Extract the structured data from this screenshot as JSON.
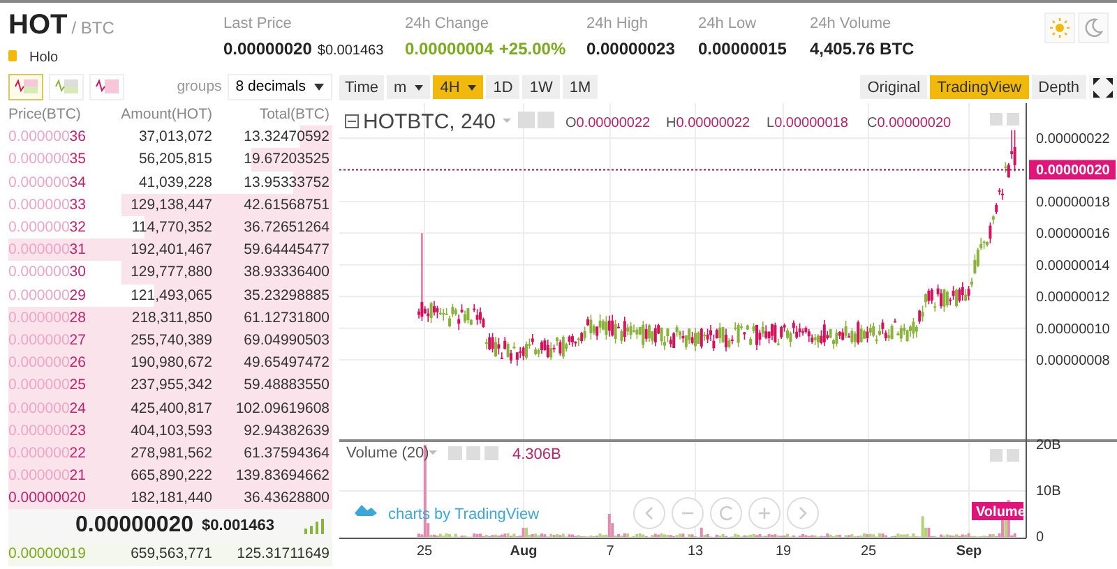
{
  "header": {
    "symbol": "HOT",
    "quote": "/ BTC",
    "name": "Holo",
    "stats": [
      {
        "label": "Last Price",
        "value": "0.00000020",
        "extra": "$0.001463"
      },
      {
        "label": "24h Change",
        "value": "0.00000004",
        "extra": "+25.00%"
      },
      {
        "label": "24h High",
        "value": "0.00000023"
      },
      {
        "label": "24h Low",
        "value": "0.00000015"
      },
      {
        "label": "24h Volume",
        "value": "4,405.76 BTC"
      }
    ]
  },
  "orderbook": {
    "view_modes": [
      {
        "selected": true
      },
      {
        "selected": false
      },
      {
        "selected": false
      }
    ],
    "groups_label": "groups",
    "groups_value": "8 decimals",
    "columns": [
      "Price(BTC)",
      "Amount(HOT)",
      "Total(BTC)"
    ],
    "asks": [
      {
        "price": "0.00000036",
        "amount": "37,013,072",
        "total": "13.32470592"
      },
      {
        "price": "0.00000035",
        "amount": "56,205,815",
        "total": "19.67203525"
      },
      {
        "price": "0.00000034",
        "amount": "41,039,228",
        "total": "13.95333752"
      },
      {
        "price": "0.00000033",
        "amount": "129,138,447",
        "total": "42.61568751"
      },
      {
        "price": "0.00000032",
        "amount": "114,770,352",
        "total": "36.72651264"
      },
      {
        "price": "0.00000031",
        "amount": "192,401,467",
        "total": "59.64445477"
      },
      {
        "price": "0.00000030",
        "amount": "129,777,880",
        "total": "38.93336400"
      },
      {
        "price": "0.00000029",
        "amount": "121,493,065",
        "total": "35.23298885"
      },
      {
        "price": "0.00000028",
        "amount": "218,311,850",
        "total": "61.12731800"
      },
      {
        "price": "0.00000027",
        "amount": "255,740,389",
        "total": "69.04990503"
      },
      {
        "price": "0.00000026",
        "amount": "190,980,672",
        "total": "49.65497472"
      },
      {
        "price": "0.00000025",
        "amount": "237,955,342",
        "total": "59.48883550"
      },
      {
        "price": "0.00000024",
        "amount": "425,400,817",
        "total": "102.09619608"
      },
      {
        "price": "0.00000023",
        "amount": "404,103,593",
        "total": "92.94382639"
      },
      {
        "price": "0.00000022",
        "amount": "278,981,562",
        "total": "61.37594364"
      },
      {
        "price": "0.00000021",
        "amount": "665,890,222",
        "total": "139.83694662"
      },
      {
        "price": "0.00000020",
        "amount": "182,181,440",
        "total": "36.43628800"
      }
    ],
    "mid": {
      "price": "0.00000020",
      "usd": "$0.001463"
    },
    "bids": [
      {
        "price": "0.00000019",
        "amount": "659,563,771",
        "total": "125.31711649"
      }
    ]
  },
  "chart": {
    "time_label": "Time",
    "intervals": [
      {
        "label": "m",
        "dropdown": true,
        "selected": false
      },
      {
        "label": "4H",
        "dropdown": true,
        "selected": true
      },
      {
        "label": "1D",
        "dropdown": false,
        "selected": false
      },
      {
        "label": "1W",
        "dropdown": false,
        "selected": false
      },
      {
        "label": "1M",
        "dropdown": false,
        "selected": false
      }
    ],
    "views": [
      {
        "label": "Original",
        "selected": false
      },
      {
        "label": "TradingView",
        "selected": true
      },
      {
        "label": "Depth",
        "selected": false
      }
    ],
    "symbol": "HOTBTC, 240",
    "ohlc": [
      {
        "key": "O",
        "value": "0.00000022"
      },
      {
        "key": "H",
        "value": "0.00000022"
      },
      {
        "key": "L",
        "value": "0.00000018"
      },
      {
        "key": "C",
        "value": "0.00000020"
      }
    ],
    "price_axis": [
      "0.00000022",
      "0.00000018",
      "0.00000016",
      "0.00000014",
      "0.00000012",
      "0.00000010",
      "0.00000008"
    ],
    "last_price_tag": "0.00000020",
    "volume_title": "Volume (20)",
    "volume_value": "4.306B",
    "volume_axis": [
      "20B",
      "10B",
      "0"
    ],
    "volume_tag": "Volume",
    "branding": "charts by TradingView",
    "time_axis": [
      {
        "label": "25",
        "bold": false
      },
      {
        "label": "Aug",
        "bold": true
      },
      {
        "label": "7",
        "bold": false
      },
      {
        "label": "13",
        "bold": false
      },
      {
        "label": "19",
        "bold": false
      },
      {
        "label": "25",
        "bold": false
      },
      {
        "label": "Sep",
        "bold": true
      }
    ]
  }
}
